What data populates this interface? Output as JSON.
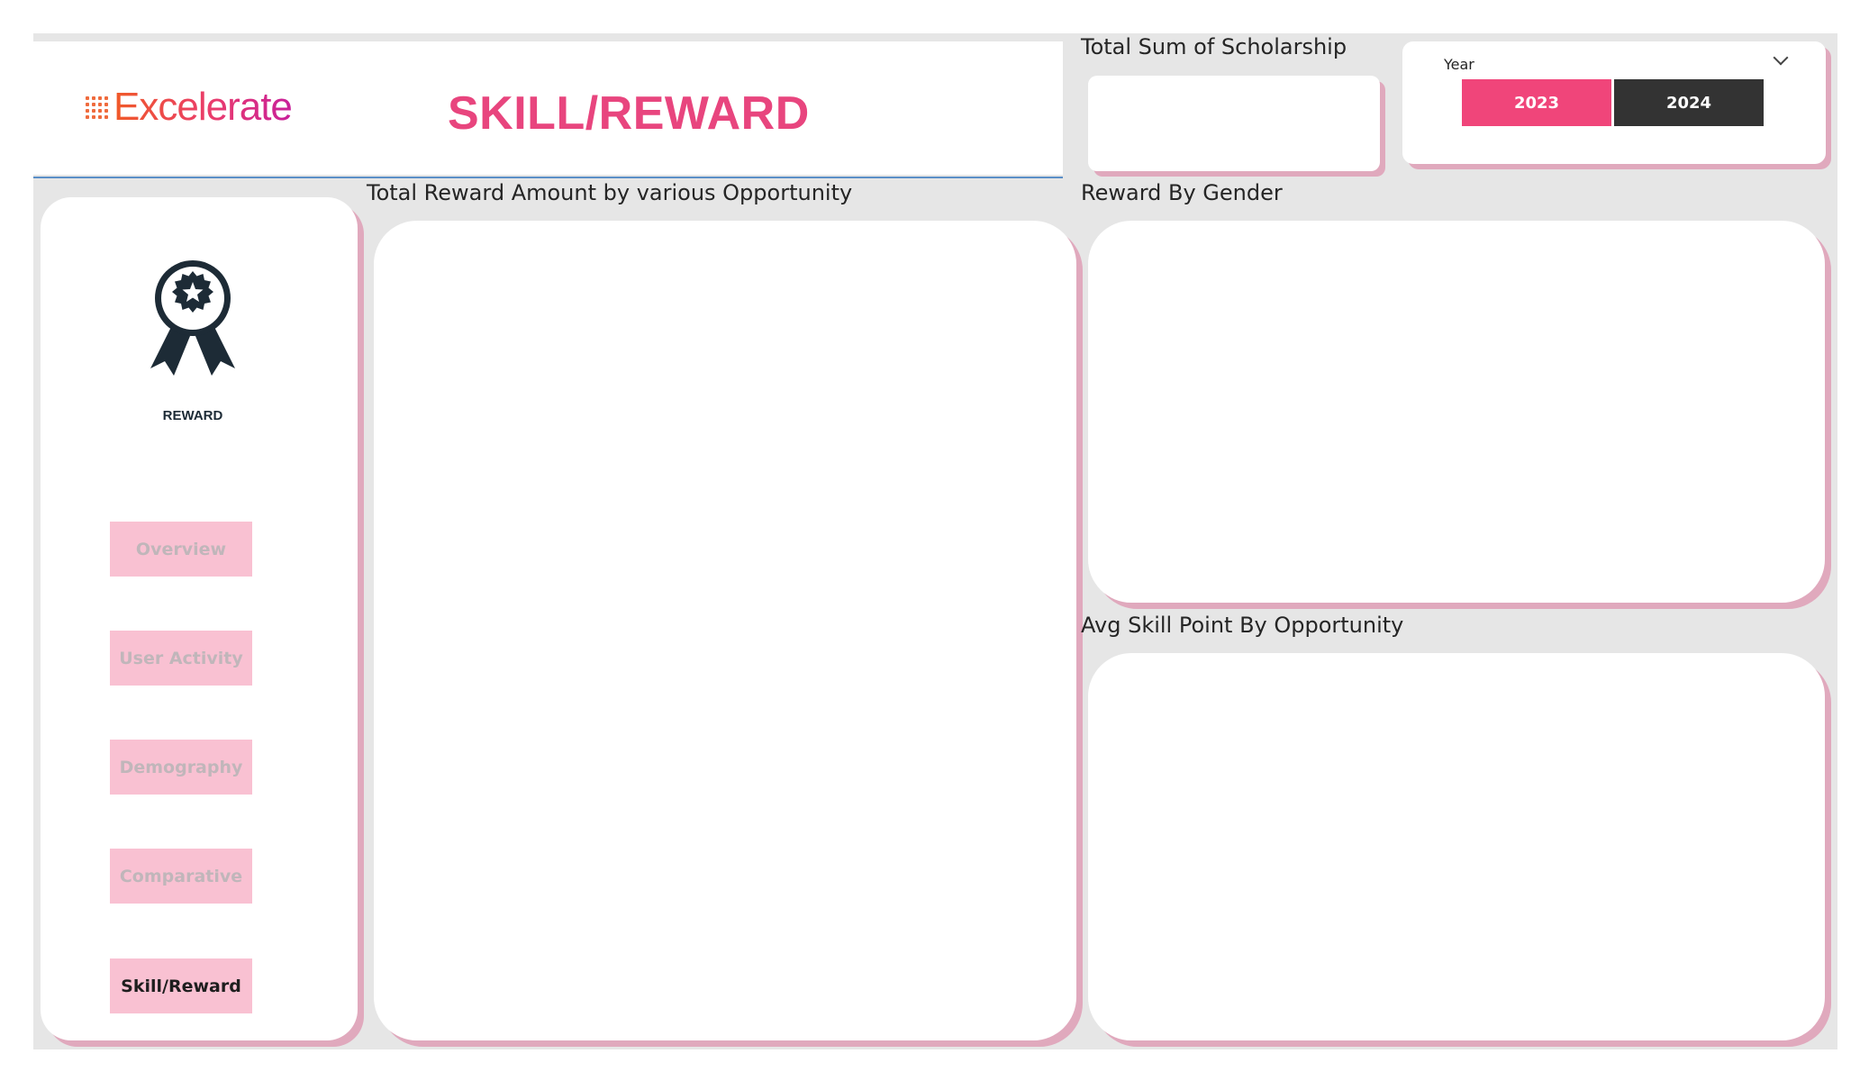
{
  "header": {
    "logo_text": "Excelerate",
    "page_title": "SKILL/REWARD"
  },
  "kpi": {
    "scholarship_label": "Total Sum of Scholarship",
    "scholarship_value": ""
  },
  "slicer": {
    "label": "Year",
    "options": [
      "2023",
      "2024"
    ],
    "selected": "2023",
    "colors": {
      "selected": "#f0457a",
      "unselected": "#333333"
    }
  },
  "sidebar": {
    "icon": "award-ribbon-icon",
    "icon_label": "REWARD",
    "nav": [
      {
        "label": "Overview",
        "active": false
      },
      {
        "label": "User Activity",
        "active": false
      },
      {
        "label": "Demography",
        "active": false
      },
      {
        "label": "Comparative",
        "active": false
      },
      {
        "label": "Skill/Reward",
        "active": true
      }
    ]
  },
  "visuals": {
    "reward_by_opportunity": {
      "title": "Total Reward Amount by various Opportunity"
    },
    "reward_by_gender": {
      "title": "Reward By Gender"
    },
    "avg_skill_point": {
      "title": "Avg  Skill Point By Opportunity"
    }
  },
  "colors": {
    "brand_pink": "#e8457e",
    "canvas_bg": "#e6e6e6",
    "card_shadow": "#e0a9bd",
    "nav_bg": "#f9c1d2",
    "icon_dark": "#1d2b36"
  }
}
